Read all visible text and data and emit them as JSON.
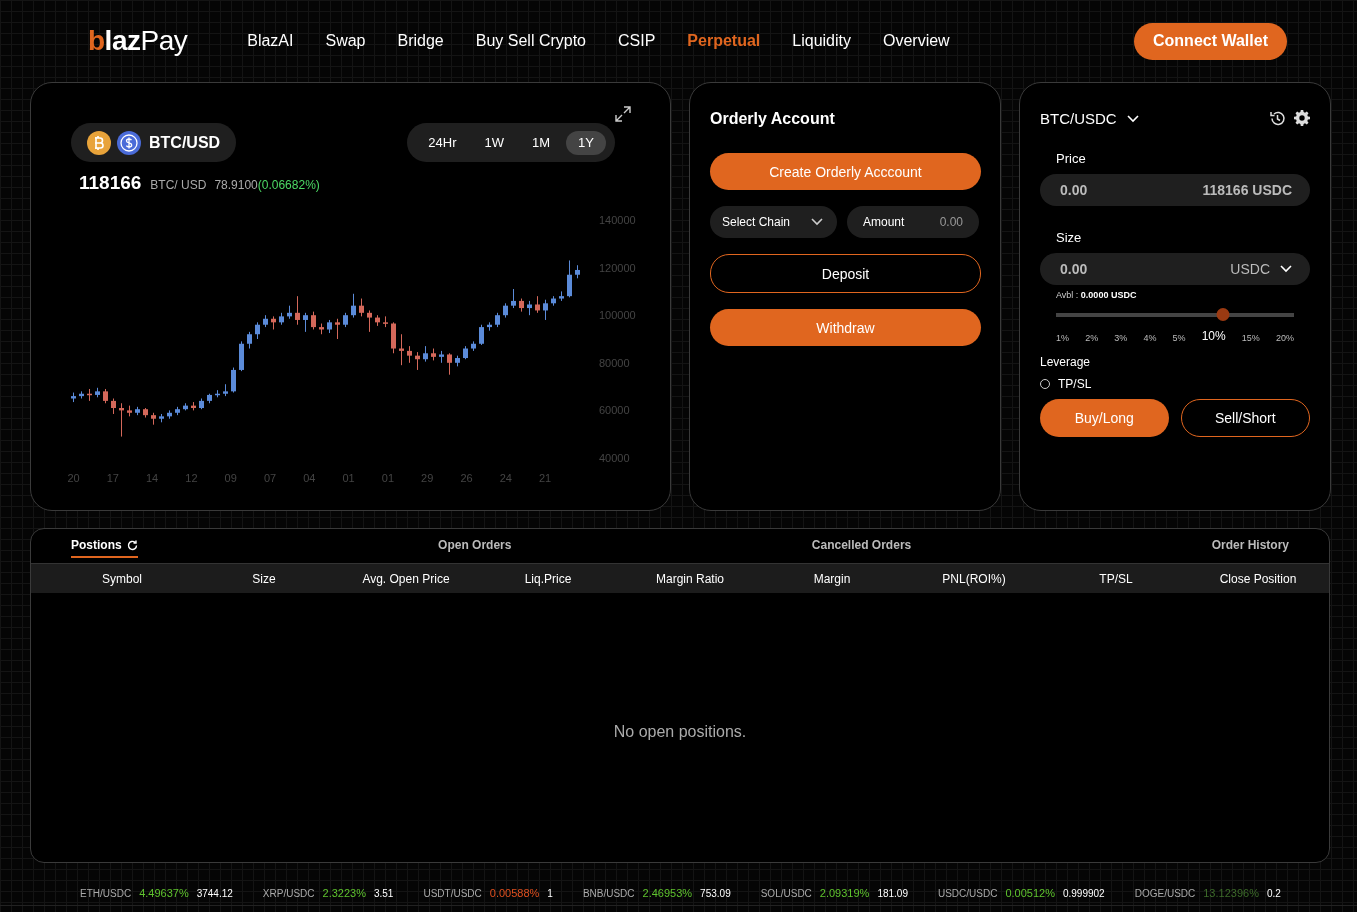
{
  "header": {
    "logo": "**blaz**Pay",
    "nav": [
      {
        "label": "BlazAI",
        "selected": false
      },
      {
        "label": "Swap",
        "selected": false
      },
      {
        "label": "Bridge",
        "selected": false
      },
      {
        "label": "Buy Sell Crypto",
        "selected": false
      },
      {
        "label": "CSIP",
        "selected": false
      },
      {
        "label": "Perpetual",
        "selected": true
      },
      {
        "label": "Liquidity",
        "selected": false
      },
      {
        "label": "Overview",
        "selected": false
      }
    ],
    "connect_button": "Connect Wallet"
  },
  "chart": {
    "pair": "BTC/USD",
    "ranges": [
      {
        "label": "24Hr",
        "selected": false
      },
      {
        "label": "1W",
        "selected": false
      },
      {
        "label": "1M",
        "selected": false
      },
      {
        "label": "1Y",
        "selected": true
      }
    ],
    "price": "118166",
    "pair_label": "BTC/ USD",
    "change": "78.9100",
    "change_pct": "(0.06682%)",
    "chart_data": {
      "type": "candlestick",
      "ylim": [
        40000,
        140000
      ],
      "yticks": [
        140000,
        120000,
        100000,
        80000,
        60000,
        40000
      ],
      "ohlc": [
        [
          65000,
          67500,
          63500,
          66000
        ],
        [
          66000,
          68000,
          65000,
          67000
        ],
        [
          67000,
          69000,
          64000,
          66500
        ],
        [
          66500,
          69500,
          65500,
          68000
        ],
        [
          68000,
          69000,
          63000,
          64000
        ],
        [
          64000,
          65000,
          58500,
          61000
        ],
        [
          61000,
          63000,
          49000,
          60000
        ],
        [
          60000,
          62000,
          57500,
          59000
        ],
        [
          59000,
          61500,
          58000,
          60500
        ],
        [
          60500,
          61000,
          57000,
          58000
        ],
        [
          58000,
          59000,
          54000,
          56500
        ],
        [
          56500,
          58500,
          55000,
          57500
        ],
        [
          57500,
          60000,
          56500,
          59000
        ],
        [
          59000,
          61500,
          58000,
          60500
        ],
        [
          60500,
          63000,
          60000,
          62000
        ],
        [
          62000,
          63500,
          60000,
          61000
        ],
        [
          61000,
          65000,
          60500,
          64000
        ],
        [
          64000,
          67000,
          63000,
          66500
        ],
        [
          66500,
          68500,
          65500,
          67000
        ],
        [
          67000,
          71000,
          66000,
          68000
        ],
        [
          68000,
          78000,
          67500,
          77000
        ],
        [
          77000,
          89000,
          76500,
          88000
        ],
        [
          88000,
          93000,
          86000,
          92000
        ],
        [
          92000,
          97000,
          90000,
          96000
        ],
        [
          96000,
          100000,
          95000,
          98500
        ],
        [
          98500,
          99500,
          94000,
          97000
        ],
        [
          97000,
          101000,
          96000,
          99500
        ],
        [
          99500,
          104000,
          98500,
          101000
        ],
        [
          101000,
          108000,
          96000,
          98000
        ],
        [
          98000,
          101000,
          93000,
          100000
        ],
        [
          100000,
          101500,
          94000,
          95000
        ],
        [
          95000,
          96500,
          92000,
          94000
        ],
        [
          94000,
          98000,
          92500,
          97000
        ],
        [
          97000,
          98500,
          90000,
          96000
        ],
        [
          96000,
          101000,
          95000,
          100000
        ],
        [
          100000,
          109000,
          99000,
          104000
        ],
        [
          104000,
          107000,
          99500,
          101000
        ],
        [
          101000,
          102000,
          93000,
          99000
        ],
        [
          99000,
          100000,
          95500,
          97000
        ],
        [
          97000,
          99500,
          95000,
          96500
        ],
        [
          96500,
          97000,
          84000,
          86000
        ],
        [
          86000,
          92000,
          79000,
          85000
        ],
        [
          85000,
          87000,
          80000,
          83000
        ],
        [
          83000,
          84500,
          77000,
          81500
        ],
        [
          81500,
          87000,
          80500,
          84000
        ],
        [
          84000,
          86000,
          81000,
          82500
        ],
        [
          82500,
          85000,
          80000,
          83500
        ],
        [
          83500,
          84000,
          75000,
          80000
        ],
        [
          80000,
          83000,
          78500,
          82000
        ],
        [
          82000,
          87000,
          81500,
          86000
        ],
        [
          86000,
          89000,
          85000,
          88000
        ],
        [
          88000,
          96000,
          87500,
          95000
        ],
        [
          95000,
          97000,
          93500,
          96000
        ],
        [
          96000,
          101000,
          95000,
          100000
        ],
        [
          100000,
          105000,
          99000,
          104000
        ],
        [
          104000,
          111000,
          103000,
          106000
        ],
        [
          106000,
          107000,
          101500,
          103000
        ],
        [
          103000,
          106000,
          100000,
          104500
        ],
        [
          104500,
          108000,
          101000,
          102000
        ],
        [
          102000,
          106500,
          98000,
          105000
        ],
        [
          105000,
          108000,
          104000,
          107000
        ],
        [
          107000,
          110000,
          106000,
          108000
        ],
        [
          108000,
          123000,
          107500,
          117000
        ],
        [
          117000,
          121000,
          115500,
          119000
        ]
      ]
    },
    "x_labels": [
      "20",
      "17",
      "14",
      "12",
      "09",
      "07",
      "04",
      "01",
      "01",
      "29",
      "26",
      "24",
      "21"
    ]
  },
  "orderly": {
    "title": "Orderly Account",
    "create_button": "Create Orderly Acccount",
    "chain_select": "Select Chain",
    "amount_label": "Amount",
    "amount_placeholder": "0.00",
    "deposit_button": "Deposit",
    "withdraw_button": "Withdraw"
  },
  "trade": {
    "pair": "BTC/USDC",
    "price_label": "Price",
    "price_value": "0.00",
    "price_quote": "118166 USDC",
    "size_label": "Size",
    "size_value": "0.00",
    "size_unit": "USDC",
    "avbl_label": "Avbl :",
    "avbl_value": "0.0000 USDC",
    "leverage": {
      "level": 0.7,
      "marks": [
        {
          "label": "1%",
          "selected": false
        },
        {
          "label": "2%",
          "selected": false
        },
        {
          "label": "3%",
          "selected": false
        },
        {
          "label": "4%",
          "selected": false
        },
        {
          "label": "5%",
          "selected": false
        },
        {
          "label": "10%",
          "selected": true
        },
        {
          "label": "15%",
          "selected": false
        },
        {
          "label": "20%",
          "selected": false
        }
      ]
    },
    "leverage_label": "Leverage",
    "tpsl": {
      "label": "TP/SL",
      "checked": false
    },
    "buy_button": "Buy/Long",
    "sell_button": "Sell/Short"
  },
  "positions": {
    "tabs": [
      {
        "label": "Postions",
        "selected": true
      },
      {
        "label": "Open Orders",
        "selected": false
      },
      {
        "label": "Cancelled Orders",
        "selected": false
      },
      {
        "label": "Order History",
        "selected": false
      }
    ],
    "columns": [
      "Symbol",
      "Size",
      "Avg. Open Price",
      "Liq.Price",
      "Margin Ratio",
      "Margin",
      "PNL(ROI%)",
      "TP/SL",
      "Close Position"
    ],
    "empty_text": "No open positions."
  },
  "ticker": [
    {
      "pair": "ETH/USDC",
      "change": "4.49637%",
      "price": "3744.12",
      "color": "#5fc32e"
    },
    {
      "pair": "XRP/USDC",
      "change": "2.3223%",
      "price": "3.51",
      "color": "#5fc32e"
    },
    {
      "pair": "USDT/USDC",
      "change": "0.00588%",
      "price": "1",
      "color": "#e0501f"
    },
    {
      "pair": "BNB/USDC",
      "change": "2.46953%",
      "price": "753.09",
      "color": "#5fc32e"
    },
    {
      "pair": "SOL/USDC",
      "change": "2.09319%",
      "price": "181.09",
      "color": "#5fc32e"
    },
    {
      "pair": "USDC/USDC",
      "change": "0.00512%",
      "price": "0.999902",
      "color": "#5fc32e"
    },
    {
      "pair": "DOGE/USDC",
      "change": "13.12396%",
      "price": "0.2",
      "color": "#3d6b2a"
    }
  ]
}
